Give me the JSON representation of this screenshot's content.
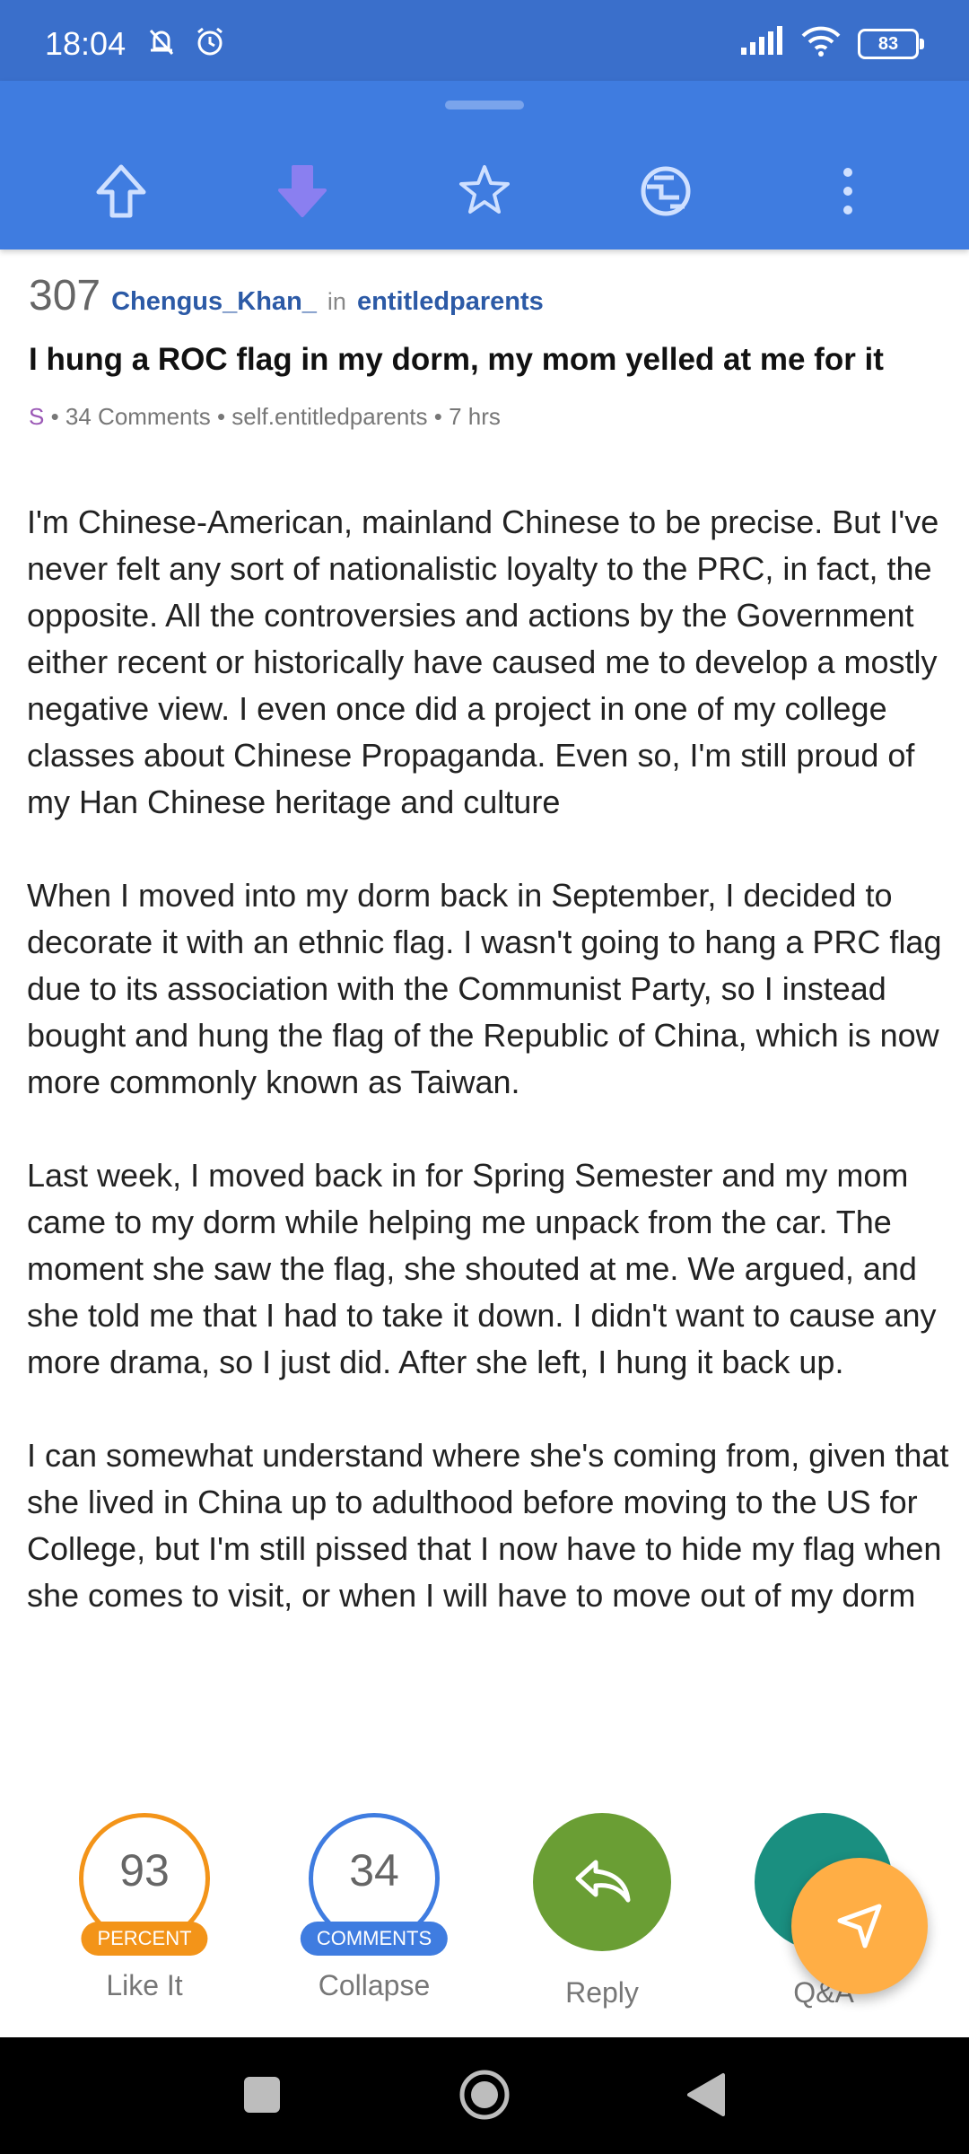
{
  "status": {
    "time": "18:04",
    "battery": "83",
    "icons_left": [
      "mute-icon",
      "alarm-icon"
    ],
    "icons_right": [
      "signal-icon",
      "wifi-icon",
      "battery-icon"
    ]
  },
  "toolbar": {
    "buttons": [
      "upvote-icon",
      "downvote-icon",
      "star-icon",
      "globe-icon",
      "more-icon"
    ],
    "colors": {
      "bar": "#3f7ce0",
      "downvote_active": "#8a7ff0"
    }
  },
  "post": {
    "score": "307",
    "author": "Chengus_Khan_",
    "in_label": "in",
    "subreddit": "entitledparents",
    "title": "I hung a ROC flag in my dorm, my mom yelled at me for it",
    "flair": "S",
    "info": " • 34 Comments • self.entitledparents • 7 hrs",
    "paragraphs": [
      "I'm Chinese-American, mainland Chinese to be precise. But I've never felt any sort of nationalistic loyalty to the PRC, in fact, the opposite. All the controversies and actions by the Government either recent or historically have caused me to develop a mostly negative view. I even once did a project in one of my college classes about Chinese Propaganda. Even so, I'm still proud of my Han Chinese heritage and culture",
      "When I moved into my dorm back in September, I decided to decorate it with an ethnic flag. I wasn't going to hang a PRC flag due to its association with the Communist Party, so I instead bought and hung the flag of the Republic of China, which is now more commonly known as Taiwan.",
      "Last week, I moved back in for Spring Semester and my mom came to my dorm while helping me unpack from the car. The moment she saw the flag, she shouted at me. We argued, and she told me that I had to take it down. I didn't want to cause any more drama, so I just did. After she left, I hung it back up.",
      "I can somewhat understand where she's coming from, given that she lived in China up to adulthood before moving to the US for College, but I'm still pissed that I now have to hide my flag when she comes to visit, or when I will have to move out of my dorm"
    ]
  },
  "actions": {
    "like": {
      "value": "93",
      "pill": "PERCENT",
      "label": "Like It",
      "color": "#f39419"
    },
    "comments": {
      "value": "34",
      "pill": "COMMENTS",
      "label": "Collapse",
      "color": "#3f7ce0"
    },
    "reply": {
      "label": "Reply",
      "color": "#6a9e34"
    },
    "qa": {
      "label": "Q&A",
      "color": "#1a8f80"
    },
    "fab_color": "#ffae45"
  },
  "nav": [
    "square-icon",
    "home-circle-icon",
    "back-triangle-icon"
  ]
}
